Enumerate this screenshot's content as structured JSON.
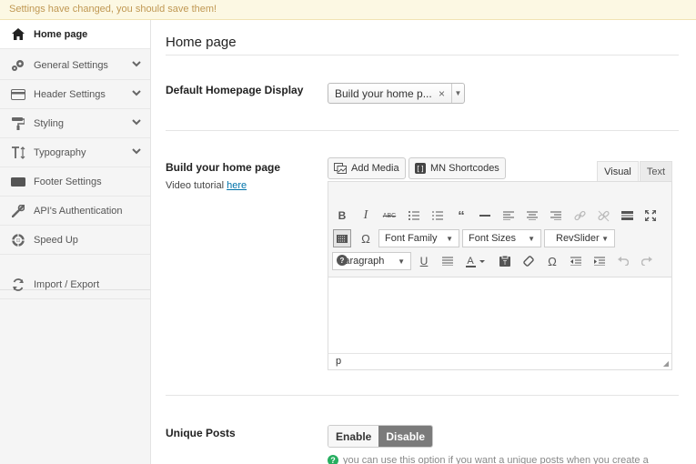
{
  "notice": {
    "text": "Settings have changed, you should save them!"
  },
  "colors": {
    "notice_bg": "#fcf8e3",
    "notice_text": "#c09853",
    "toggle_active": "#7b7b7b",
    "help_icon": "#27ae60",
    "link": "#0073aa"
  },
  "sidebar": {
    "items": [
      {
        "label": "Home page",
        "icon": "home-icon",
        "active": true
      },
      {
        "label": "General Settings",
        "icon": "gears-icon",
        "expandable": true
      },
      {
        "label": "Header Settings",
        "icon": "credit-card-icon",
        "expandable": true
      },
      {
        "label": "Styling",
        "icon": "paint-roller-icon",
        "expandable": true
      },
      {
        "label": "Typography",
        "icon": "text-height-icon",
        "expandable": true
      },
      {
        "label": "Footer Settings",
        "icon": "keyboard-icon"
      },
      {
        "label": "API's Authentication",
        "icon": "wrench-icon"
      },
      {
        "label": "Speed Up",
        "icon": "lifebuoy-icon"
      },
      {
        "label": "Import / Export",
        "icon": "refresh-icon"
      }
    ]
  },
  "main": {
    "title": "Home page",
    "homepage_display": {
      "label": "Default Homepage Display",
      "value": "Build your home p...",
      "clear": "×"
    },
    "builder": {
      "label": "Build your home page",
      "tutorial_prefix": "Video tutorial ",
      "tutorial_link": "here",
      "add_media": "Add Media",
      "shortcodes": "MN Shortcodes",
      "tab_visual": "Visual",
      "tab_text": "Text",
      "font_family": "Font Family",
      "font_sizes": "Font Sizes",
      "revslider": "RevSlider",
      "paragraph": "Paragraph",
      "path": "p"
    },
    "unique_posts": {
      "label": "Unique Posts",
      "enable": "Enable",
      "disable": "Disable",
      "selected": "Disable",
      "help": "you can use this option if you want a unique posts when you create a"
    }
  }
}
